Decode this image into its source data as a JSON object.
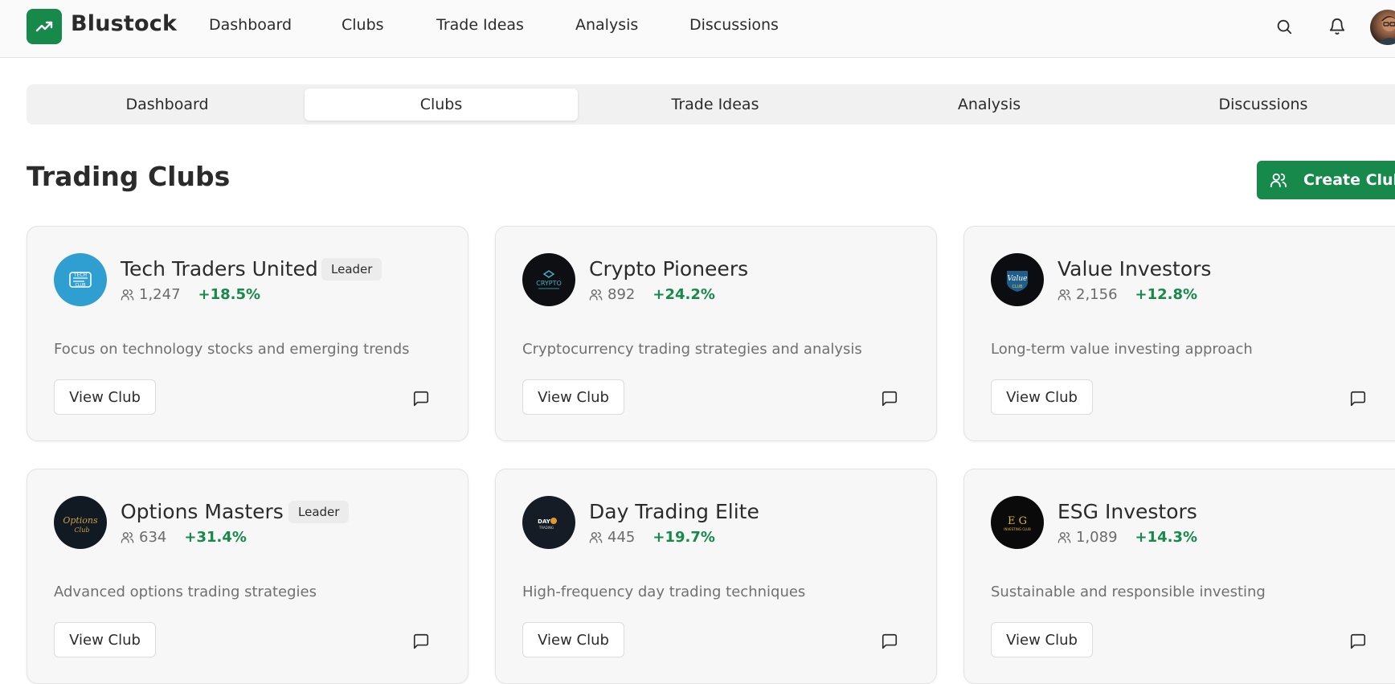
{
  "app": {
    "brand": "Blustock",
    "brand_color": "#16894b"
  },
  "topnav": {
    "items": [
      "Dashboard",
      "Clubs",
      "Trade Ideas",
      "Analysis",
      "Discussions"
    ],
    "icons": [
      "search-icon",
      "bell-icon"
    ]
  },
  "tabs": {
    "items": [
      "Dashboard",
      "Clubs",
      "Trade Ideas",
      "Analysis",
      "Discussions"
    ],
    "active": "Clubs"
  },
  "page": {
    "title": "Trading Clubs",
    "create_label": "Create Club"
  },
  "clubs": [
    {
      "name": "Tech Traders United",
      "badge": "Leader",
      "members": "1,247",
      "performance": "+18.5%",
      "description": "Focus on technology stocks and emerging trends",
      "view_label": "View Club",
      "logo_text": "TECH CLUB"
    },
    {
      "name": "Crypto Pioneers",
      "badge": "",
      "members": "892",
      "performance": "+24.2%",
      "description": "Cryptocurrency trading strategies and analysis",
      "view_label": "View Club",
      "logo_text": "CRYPTO"
    },
    {
      "name": "Value Investors",
      "badge": "",
      "members": "2,156",
      "performance": "+12.8%",
      "description": "Long-term value investing approach",
      "view_label": "View Club",
      "logo_text": "Value"
    },
    {
      "name": "Options Masters",
      "badge": "Leader",
      "members": "634",
      "performance": "+31.4%",
      "description": "Advanced options trading strategies",
      "view_label": "View Club",
      "logo_text": "Options"
    },
    {
      "name": "Day Trading Elite",
      "badge": "",
      "members": "445",
      "performance": "+19.7%",
      "description": "High-frequency day trading techniques",
      "view_label": "View Club",
      "logo_text": "DAY"
    },
    {
      "name": "ESG Investors",
      "badge": "",
      "members": "1,089",
      "performance": "+14.3%",
      "description": "Sustainable and responsible investing",
      "view_label": "View Club",
      "logo_text": "E G"
    }
  ]
}
